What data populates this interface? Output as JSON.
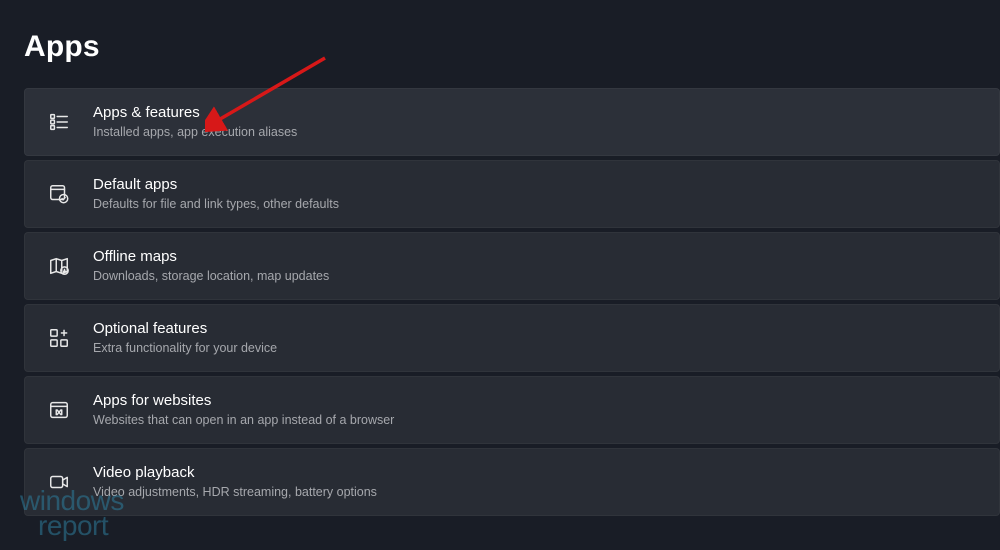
{
  "page": {
    "title": "Apps"
  },
  "items": [
    {
      "id": "apps-features",
      "title": "Apps & features",
      "desc": "Installed apps, app execution aliases",
      "highlight": true
    },
    {
      "id": "default-apps",
      "title": "Default apps",
      "desc": "Defaults for file and link types, other defaults",
      "highlight": false
    },
    {
      "id": "offline-maps",
      "title": "Offline maps",
      "desc": "Downloads, storage location, map updates",
      "highlight": false
    },
    {
      "id": "optional-features",
      "title": "Optional features",
      "desc": "Extra functionality for your device",
      "highlight": false
    },
    {
      "id": "apps-for-websites",
      "title": "Apps for websites",
      "desc": "Websites that can open in an app instead of a browser",
      "highlight": false
    },
    {
      "id": "video-playback",
      "title": "Video playback",
      "desc": "Video adjustments, HDR streaming, battery options",
      "highlight": false
    }
  ],
  "watermark": {
    "line1": "windows",
    "line2": "report"
  },
  "annotation": {
    "arrow_color": "#d71818"
  }
}
